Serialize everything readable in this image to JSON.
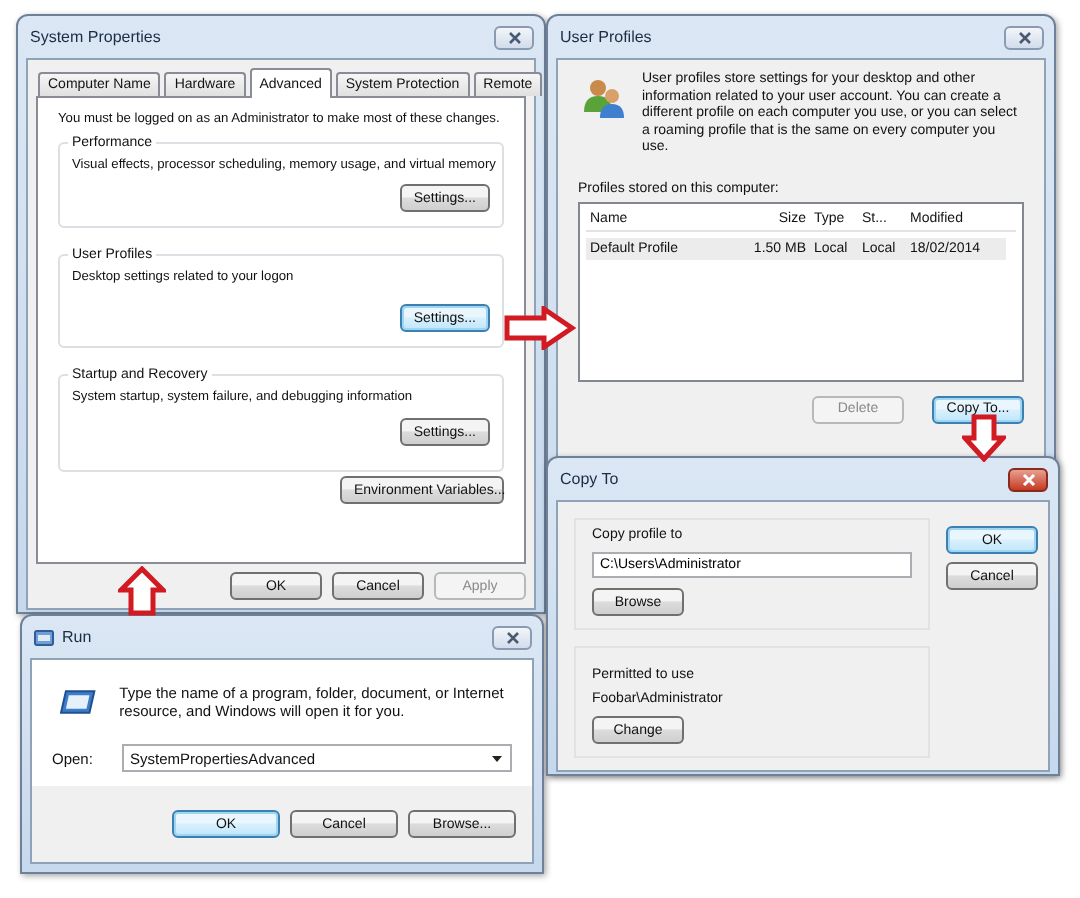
{
  "system_properties": {
    "title": "System Properties",
    "tabs": [
      {
        "label": "Computer Name",
        "selected": false
      },
      {
        "label": "Hardware",
        "selected": false
      },
      {
        "label": "Advanced",
        "selected": true
      },
      {
        "label": "System Protection",
        "selected": false
      },
      {
        "label": "Remote",
        "selected": false
      }
    ],
    "notice": "You must be logged on as an Administrator to make most of these changes.",
    "groups": [
      {
        "title": "Performance",
        "description": "Visual effects, processor scheduling, memory usage, and virtual memory",
        "button": {
          "label": "Settings...",
          "focused": false
        }
      },
      {
        "title": "User Profiles",
        "description": "Desktop settings related to your logon",
        "button": {
          "label": "Settings...",
          "focused": true
        }
      },
      {
        "title": "Startup and Recovery",
        "description": "System startup, system failure, and debugging information",
        "button": {
          "label": "Settings...",
          "focused": false
        }
      }
    ],
    "environment_button": "Environment Variables...",
    "buttons": [
      {
        "label": "OK",
        "disabled": false,
        "focused": false
      },
      {
        "label": "Cancel",
        "disabled": false,
        "focused": false
      },
      {
        "label": "Apply",
        "disabled": true,
        "focused": false
      }
    ]
  },
  "user_profiles": {
    "title": "User Profiles",
    "description": "User profiles store settings for your desktop and other information related to your user account. You can create a different profile on each computer you use, or you can select a roaming profile that is the same on every computer you use.",
    "list_label": "Profiles stored on this computer:",
    "columns": [
      "Name",
      "Size",
      "Type",
      "St...",
      "Modified"
    ],
    "rows": [
      {
        "cells": [
          "Default Profile",
          "1.50 MB",
          "Local",
          "Local",
          "18/02/2014"
        ],
        "selected": true
      }
    ],
    "buttons": [
      {
        "label": "Delete",
        "disabled": true,
        "focused": false
      },
      {
        "label": "Copy To...",
        "disabled": false,
        "focused": true
      }
    ]
  },
  "copy_to": {
    "title": "Copy To",
    "copy_label": "Copy profile to",
    "path": "C:\\Users\\Administrator",
    "browse_button": "Browse",
    "permitted_label": "Permitted to use",
    "permitted_user": "Foobar\\Administrator",
    "change_button": "Change",
    "buttons": [
      {
        "label": "OK",
        "disabled": false,
        "focused": true
      },
      {
        "label": "Cancel",
        "disabled": false,
        "focused": false
      }
    ]
  },
  "run": {
    "title": "Run",
    "description": "Type the name of a program, folder, document, or Internet resource, and Windows will open it for you.",
    "open_label": "Open:",
    "command": "SystemPropertiesAdvanced",
    "buttons": [
      {
        "label": "OK",
        "disabled": false,
        "focused": true
      },
      {
        "label": "Cancel",
        "disabled": false,
        "focused": false
      },
      {
        "label": "Browse...",
        "disabled": false,
        "focused": false
      }
    ]
  }
}
